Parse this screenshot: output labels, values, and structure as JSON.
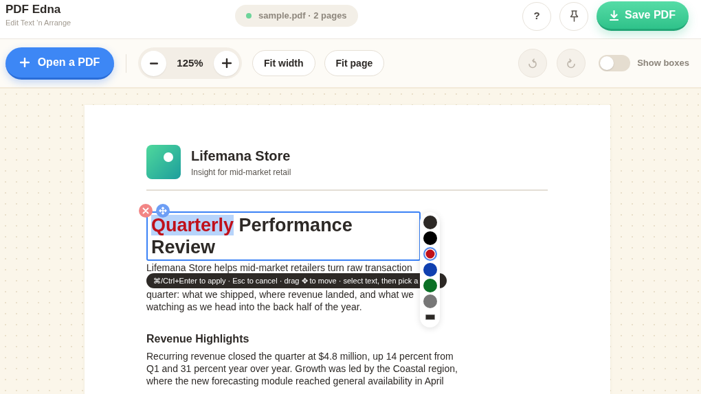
{
  "app": {
    "title": "PDF Edna",
    "subtitle": "Edit Text ’n Arrange"
  },
  "file_status": {
    "label": "sample.pdf · 2 pages",
    "loaded": true
  },
  "header_actions": {
    "help": "?",
    "save": "Save PDF"
  },
  "toolbar": {
    "open": "Open a PDF",
    "zoom": "125%",
    "fit_buttons": [
      "Fit width",
      "Fit page"
    ],
    "history": [
      {
        "kind": "undo",
        "disabled": true
      },
      {
        "kind": "redo",
        "disabled": true
      }
    ],
    "show_boxes": {
      "label": "Show boxes",
      "on": false
    }
  },
  "page": {
    "brand": {
      "name": "Lifemana Store",
      "tagline": "Insight for mid-market retail"
    },
    "editor": {
      "runs": [
        {
          "text": "Quarterly",
          "color": "#c0101a",
          "selected": true
        },
        {
          "text": "Performance Review",
          "color": "#2d2926",
          "selected": false
        }
      ]
    },
    "hint": "⌘/Ctrl+Enter to apply · Esc to cancel · drag ✥ to move · select text, then pick a",
    "palette": [
      {
        "color": "#2d2926",
        "selected": false
      },
      {
        "color": "#000000",
        "selected": false
      },
      {
        "color": "#c0101a",
        "selected": true
      },
      {
        "color": "#1040b0",
        "selected": false
      },
      {
        "color": "#0b7026",
        "selected": false
      },
      {
        "color": "#777777",
        "selected": false
      }
    ],
    "intro": {
      "top_line": "Lifemana Store helps mid-market retailers turn raw transaction",
      "lines": [
        "quarter: what we shipped, where revenue landed, and what we",
        "watching as we head into the back half of the year."
      ]
    },
    "section": {
      "heading": "Revenue Highlights",
      "body": "Recurring revenue closed the quarter at $4.8 million, up 14 percent from Q1 and 31 percent year over year. Growth was led by the Coastal region, where the new forecasting module reached general availability in April"
    }
  }
}
